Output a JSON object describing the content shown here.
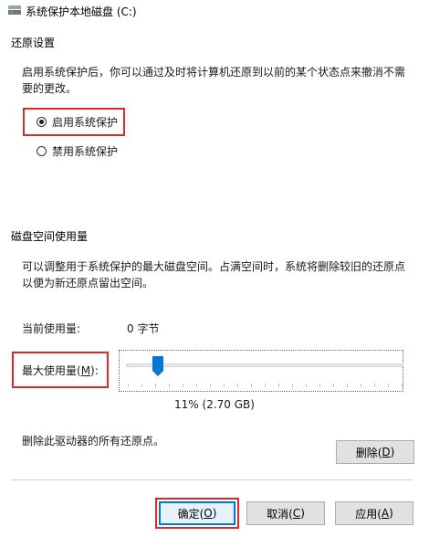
{
  "window": {
    "title": "系统保护本地磁盘 (C:)",
    "icon": "drive-icon"
  },
  "restore_settings": {
    "group_label": "还原设置",
    "description": "启用系统保护后，你可以通过及时将计算机还原到以前的某个状态点来撤消不需要的更改。",
    "options": [
      {
        "label": "启用系统保护",
        "selected": true
      },
      {
        "label": "禁用系统保护",
        "selected": false
      }
    ]
  },
  "disk_usage": {
    "group_label": "磁盘空间使用量",
    "description": "可以调整用于系统保护的最大磁盘空间。占满空间时，系统将删除较旧的还原点以便为新还原点留出空间。",
    "current_usage_label": "当前使用量:",
    "current_usage_value": "0 字节",
    "max_usage_label_prefix": "最大使用量(",
    "max_usage_label_key": "M",
    "max_usage_label_suffix": "):",
    "slider_value_text": "11% (2.70 GB)",
    "slider_percent": 11
  },
  "delete_section": {
    "text": "删除此驱动器的所有还原点。",
    "button_prefix": "删除(",
    "button_key": "D",
    "button_suffix": ")"
  },
  "footer": {
    "ok_prefix": "确定(",
    "ok_key": "O",
    "ok_suffix": ")",
    "cancel_prefix": "取消(",
    "cancel_key": "C",
    "cancel_suffix": ")",
    "apply_prefix": "应用(",
    "apply_key": "A",
    "apply_suffix": ")"
  },
  "colors": {
    "highlight_box": "#e02a2a",
    "slider_thumb": "#0078d7",
    "default_button_border": "#0078d7"
  }
}
